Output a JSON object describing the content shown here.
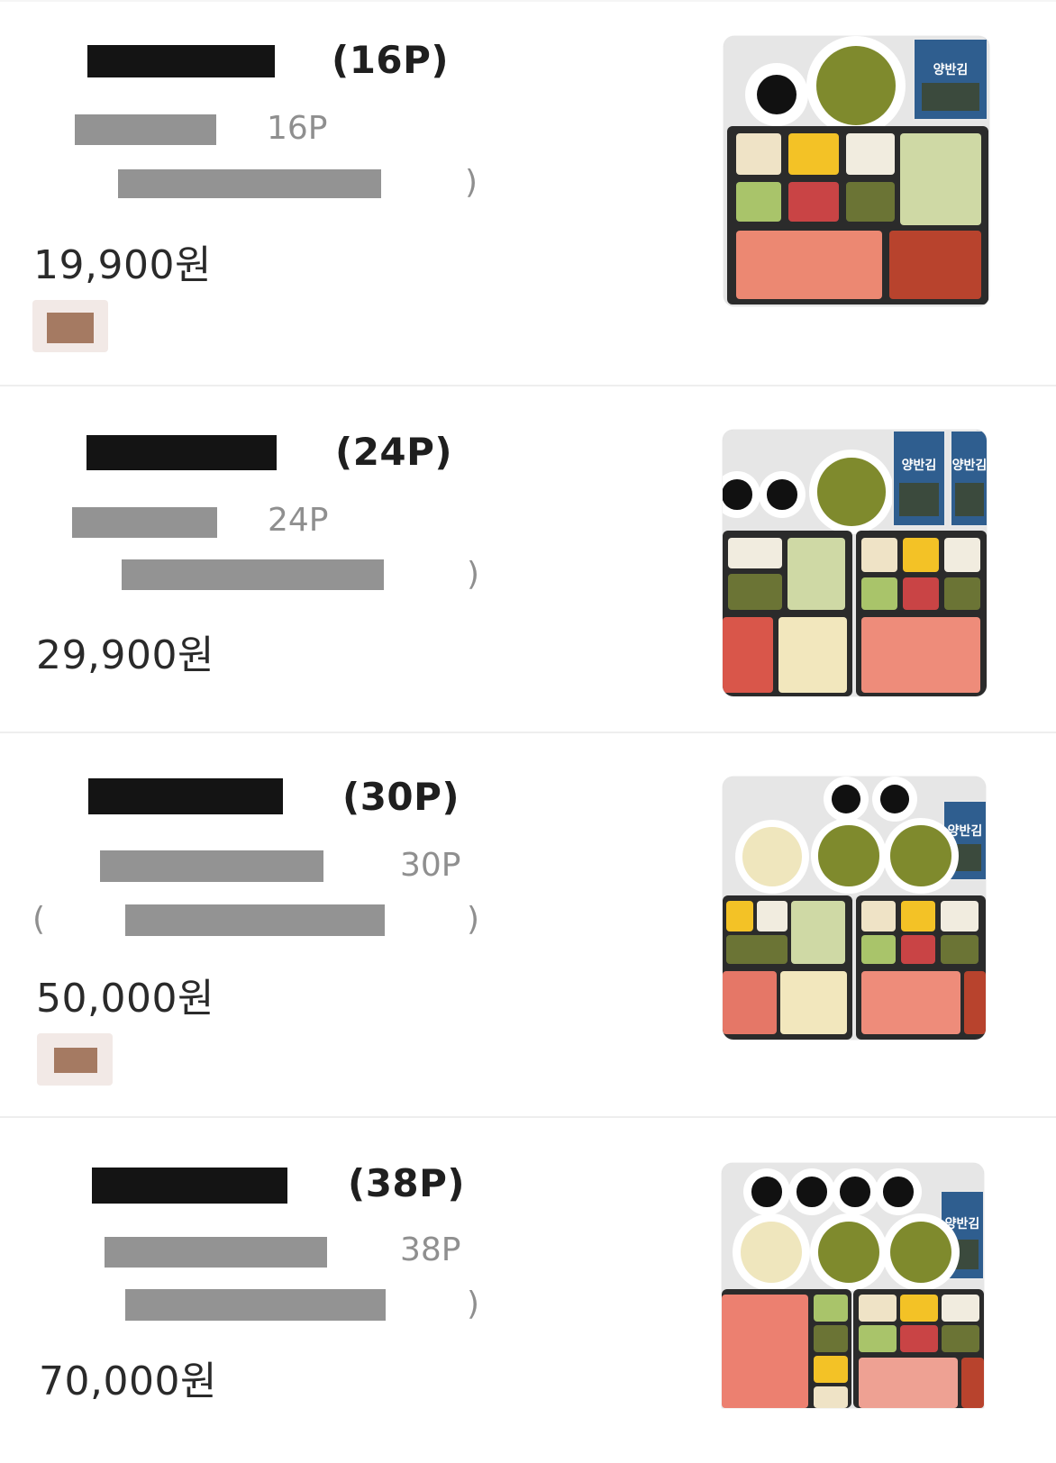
{
  "items": [
    {
      "title_suffix": "(16P)",
      "servings": "16P",
      "paren": ")",
      "price": "19,900원",
      "has_badge": true
    },
    {
      "title_suffix": "(24P)",
      "servings": "24P",
      "paren": ")",
      "price": "29,900원",
      "has_badge": false
    },
    {
      "title_suffix": "(30P)",
      "servings": "30P",
      "paren_left": "(",
      "paren": ")",
      "price": "50,000원",
      "has_badge": true
    },
    {
      "title_suffix": "(38P)",
      "servings": "38P",
      "paren": ")",
      "price": "70,000원",
      "has_badge": false
    }
  ],
  "seaweed_label": "양반김",
  "colors": {
    "redaction_black": "#141414",
    "redaction_gray": "#939393",
    "badge_bg": "#f2e9e6",
    "badge_swatch": "#a57a62",
    "divider": "#eeeeee"
  }
}
